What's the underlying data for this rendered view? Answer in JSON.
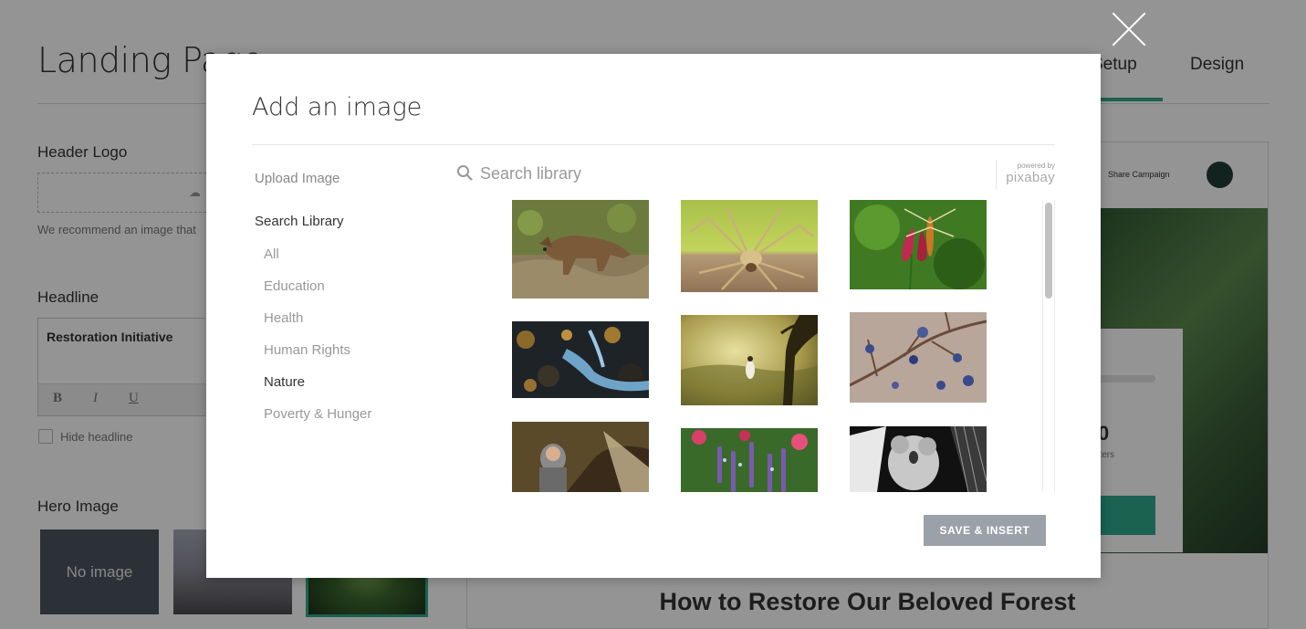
{
  "background": {
    "page_title": "Landing Page",
    "tabs": [
      {
        "label": "Setup"
      },
      {
        "label": "Design"
      }
    ],
    "header_logo_label": "Header Logo",
    "logo_hint": "We recommend an image that",
    "headline_label": "Headline",
    "headline_value": "Restoration Initiative",
    "format_buttons": [
      "B",
      "I",
      "U"
    ],
    "hide_headline_label": "Hide headline",
    "hero_image_label": "Hero Image",
    "no_image_label": "No image",
    "share_label": "Share Campaign",
    "supporters_count": "0",
    "supporters_label": "porters",
    "bottom_title": "How to Restore Our Beloved Forest"
  },
  "modal": {
    "title": "Add an image",
    "nav": {
      "upload": "Upload Image",
      "search": "Search Library",
      "categories": [
        {
          "label": "All",
          "active": false
        },
        {
          "label": "Education",
          "active": false
        },
        {
          "label": "Health",
          "active": false
        },
        {
          "label": "Human Rights",
          "active": false
        },
        {
          "label": "Nature",
          "active": true
        },
        {
          "label": "Poverty & Hunger",
          "active": false
        }
      ]
    },
    "search": {
      "placeholder": "Search library",
      "value": ""
    },
    "pixabay": {
      "powered": "powered by",
      "name": "pixabay"
    },
    "images": [
      {
        "icon": "wolf-photo"
      },
      {
        "icon": "spider-photo"
      },
      {
        "icon": "dragonfly-photo"
      },
      {
        "icon": "waterfall-photo"
      },
      {
        "icon": "misty-tree-photo"
      },
      {
        "icon": "blueberry-branch-photo"
      },
      {
        "icon": "child-in-tent-photo"
      },
      {
        "icon": "lavender-photo"
      },
      {
        "icon": "koala-photo"
      }
    ],
    "save_label": "SAVE & INSERT"
  }
}
